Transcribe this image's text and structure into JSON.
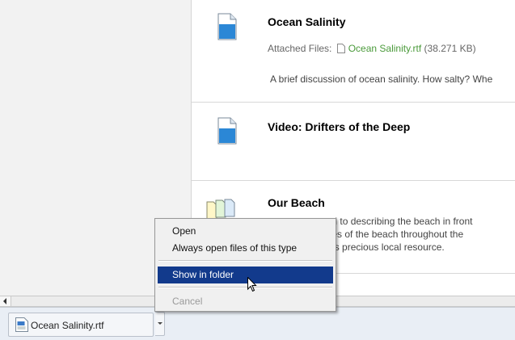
{
  "items": [
    {
      "title": "Ocean Salinity",
      "attached_label": "Attached Files:",
      "attached_file": "Ocean Salinity.rtf",
      "attached_size": "(38.271 KB)",
      "description": "A brief discussion of ocean salinity. How salty? Whe"
    },
    {
      "title": "Video: Drifters of the Deep"
    },
    {
      "title": "Our Beach",
      "description_lines": [
        "evoted to describing the beach in front",
        "pictures of the beach throughout the",
        "out this precious local resource."
      ]
    }
  ],
  "context_menu": {
    "open": "Open",
    "always_open": "Always open files of this type",
    "show_in_folder": "Show in folder",
    "cancel": "Cancel"
  },
  "download_bar": {
    "file_name": "Ocean Salinity.rtf"
  },
  "colors": {
    "highlight": "#123a8c",
    "link": "#4a9a3a",
    "icon_blue": "#2b87d6"
  }
}
